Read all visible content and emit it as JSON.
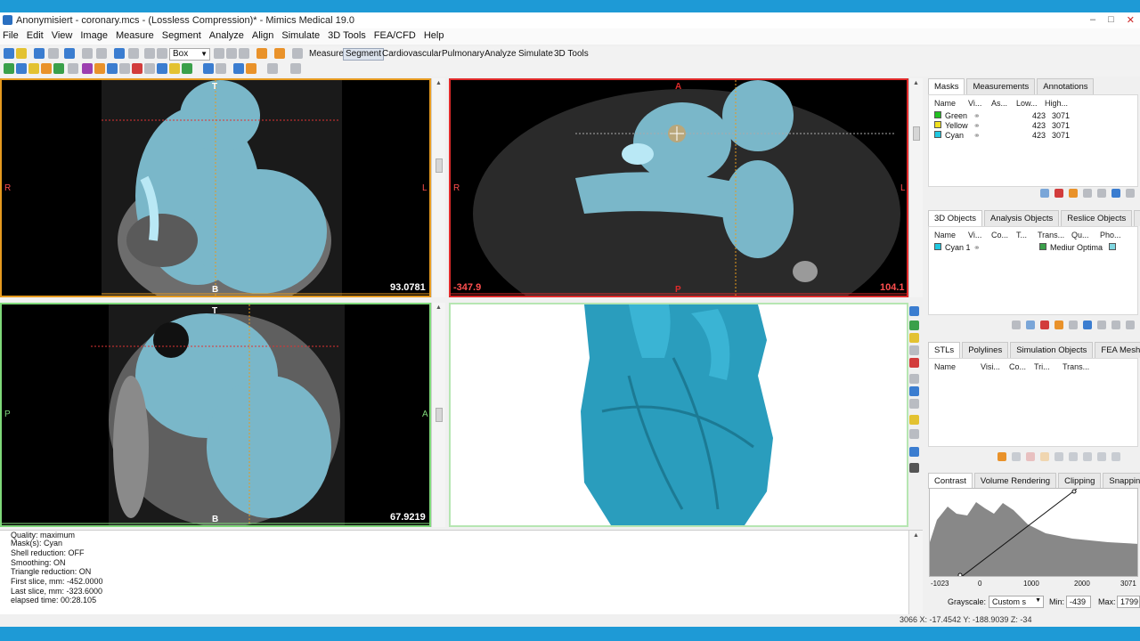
{
  "window": {
    "title": "Anonymisiert - coronary.mcs - (Lossless Compression)* - Mimics Medical 19.0",
    "controls": [
      "–",
      "□",
      "✕"
    ]
  },
  "menu": [
    "File",
    "Edit",
    "View",
    "Image",
    "Measure",
    "Segment",
    "Analyze",
    "Align",
    "Simulate",
    "3D Tools",
    "FEA/CFD",
    "Help"
  ],
  "toolbar": {
    "select_value": "Box",
    "mode_tabs": [
      "Measure",
      "Segment",
      "Cardiovascular",
      "Pulmonary",
      "Analyze",
      "Simulate",
      "3D Tools"
    ],
    "active_mode": "Segment"
  },
  "viewports": {
    "coronal": {
      "top": "T",
      "bottom": "B",
      "left": "R",
      "right": "L",
      "value": "93.0781"
    },
    "axial": {
      "top": "A",
      "bottom": "P",
      "left": "R",
      "right": "L",
      "value_left": "-347.9",
      "value_right": "104.1"
    },
    "sagittal": {
      "top": "T",
      "bottom": "B",
      "left": "P",
      "right": "A",
      "value": "67.9219"
    }
  },
  "log": [
    "Quality: maximum",
    "Mask(s): Cyan",
    "Shell reduction: OFF",
    "Smoothing: ON",
    "Triangle reduction: ON",
    "First slice, mm: -452.0000",
    "Last slice, mm: -323.6000",
    "elapsed time: 00:28.105"
  ],
  "masks_panel": {
    "tabs": [
      "Masks",
      "Measurements",
      "Annotations"
    ],
    "columns": [
      "Name",
      "Vi...",
      "As...",
      "Low...",
      "High..."
    ],
    "rows": [
      {
        "name": "Green",
        "low": "423",
        "high": "3071",
        "color": "#22c022"
      },
      {
        "name": "Yellow",
        "low": "423",
        "high": "3071",
        "color": "#f0e020"
      },
      {
        "name": "Cyan",
        "low": "423",
        "high": "3071",
        "color": "#20c8e0"
      }
    ]
  },
  "objects_panel": {
    "tabs": [
      "3D Objects",
      "Analysis Objects",
      "Reslice Objects",
      "Sk"
    ],
    "columns": [
      "Name",
      "Vi...",
      "Co...",
      "T...",
      "Trans...",
      "Qu...",
      "Pho..."
    ],
    "rows": [
      {
        "name": "Cyan 1",
        "trans": "Mediur",
        "quality": "Optima",
        "color": "#20c8e0"
      }
    ]
  },
  "stl_panel": {
    "tabs": [
      "STLs",
      "Polylines",
      "Simulation Objects",
      "FEA Mesh"
    ],
    "columns": [
      "Name",
      "Visi...",
      "Co...",
      "Tri...",
      "Trans..."
    ]
  },
  "contrast_panel": {
    "tabs": [
      "Contrast",
      "Volume Rendering",
      "Clipping",
      "Snapping"
    ],
    "axis_labels": [
      "-1023",
      "0",
      "1000",
      "2000",
      "3071"
    ],
    "grayscale_label": "Grayscale:",
    "grayscale_value": "Custom s",
    "min_label": "Min:",
    "min_value": "-439",
    "max_label": "Max:",
    "max_value": "1799"
  },
  "status": {
    "text": "3066   X: -17.4542  Y: -188.9039  Z: -34"
  }
}
